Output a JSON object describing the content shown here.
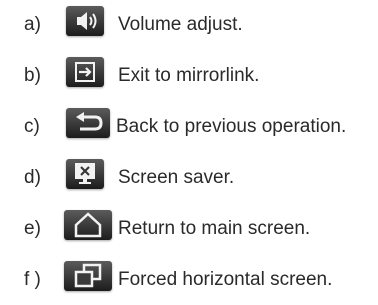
{
  "items": [
    {
      "letter": "a)",
      "label": "Volume adjust.",
      "icon": "volume-icon"
    },
    {
      "letter": "b)",
      "label": "Exit to mirrorlink.",
      "icon": "exit-icon"
    },
    {
      "letter": "c)",
      "label": "Back to previous operation.",
      "icon": "back-arrow-icon"
    },
    {
      "letter": "d)",
      "label": "Screen saver.",
      "icon": "screen-saver-icon"
    },
    {
      "letter": "e)",
      "label": "Return to main screen.",
      "icon": "home-icon"
    },
    {
      "letter": "f )",
      "label": "Forced horizontal screen.",
      "icon": "rotate-screen-icon"
    }
  ]
}
